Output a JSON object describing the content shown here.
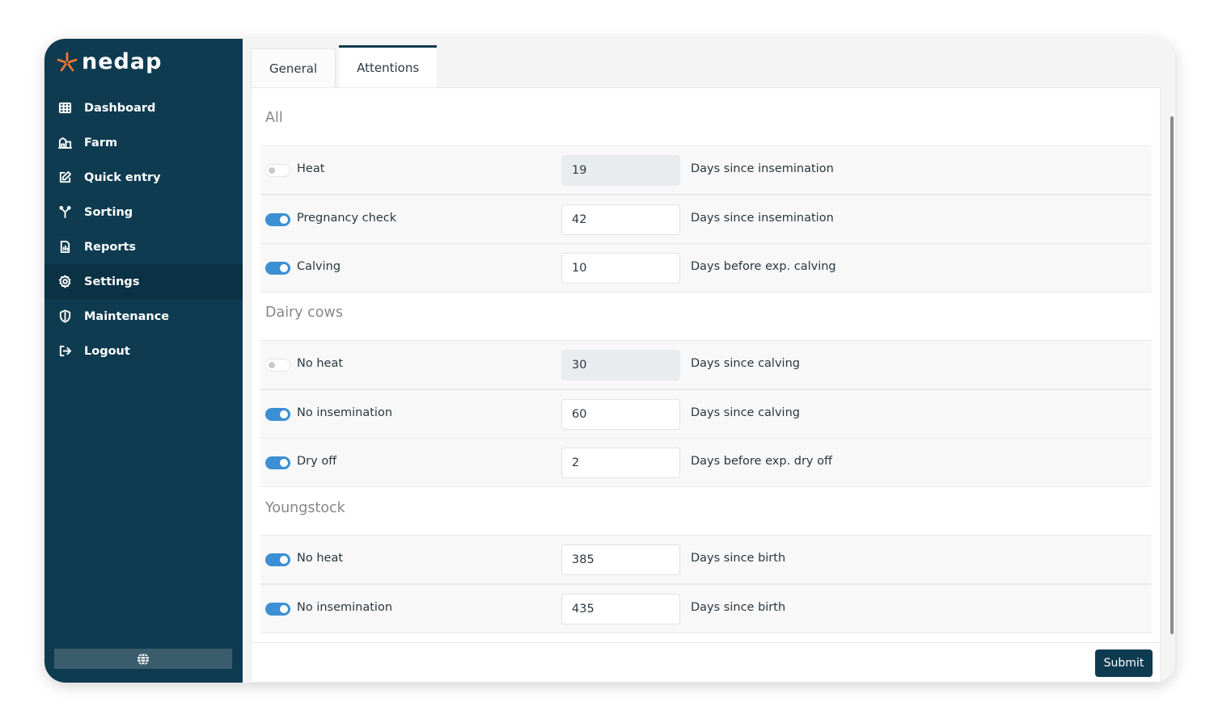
{
  "brand": {
    "name": "nedap",
    "star_color": "#ff7a2f"
  },
  "sidebar": {
    "items": [
      {
        "label": "Dashboard",
        "icon": "grid-icon"
      },
      {
        "label": "Farm",
        "icon": "farm-icon"
      },
      {
        "label": "Quick entry",
        "icon": "edit-icon"
      },
      {
        "label": "Sorting",
        "icon": "sorting-icon"
      },
      {
        "label": "Reports",
        "icon": "report-icon"
      },
      {
        "label": "Settings",
        "icon": "gear-icon",
        "active": true
      },
      {
        "label": "Maintenance",
        "icon": "shield-icon"
      },
      {
        "label": "Logout",
        "icon": "logout-icon"
      }
    ],
    "language_icon": "globe-icon"
  },
  "tabs": [
    {
      "label": "General",
      "active": false
    },
    {
      "label": "Attentions",
      "active": true
    }
  ],
  "sections": [
    {
      "title": "All",
      "rows": [
        {
          "label": "Heat",
          "enabled": false,
          "value": "19",
          "unit": "Days since insemination"
        },
        {
          "label": "Pregnancy check",
          "enabled": true,
          "value": "42",
          "unit": "Days since insemination"
        },
        {
          "label": "Calving",
          "enabled": true,
          "value": "10",
          "unit": "Days before exp. calving"
        }
      ]
    },
    {
      "title": "Dairy cows",
      "rows": [
        {
          "label": "No heat",
          "enabled": false,
          "value": "30",
          "unit": "Days since calving"
        },
        {
          "label": "No insemination",
          "enabled": true,
          "value": "60",
          "unit": "Days since calving"
        },
        {
          "label": "Dry off",
          "enabled": true,
          "value": "2",
          "unit": "Days before exp. dry off"
        }
      ]
    },
    {
      "title": "Youngstock",
      "rows": [
        {
          "label": "No heat",
          "enabled": true,
          "value": "385",
          "unit": "Days since birth"
        },
        {
          "label": "No insemination",
          "enabled": true,
          "value": "435",
          "unit": "Days since birth"
        }
      ]
    }
  ],
  "submit_label": "Submit",
  "colors": {
    "sidebar": "#0e3b50",
    "toggle_on": "#3b8fd4",
    "accent": "#0e3b50"
  }
}
